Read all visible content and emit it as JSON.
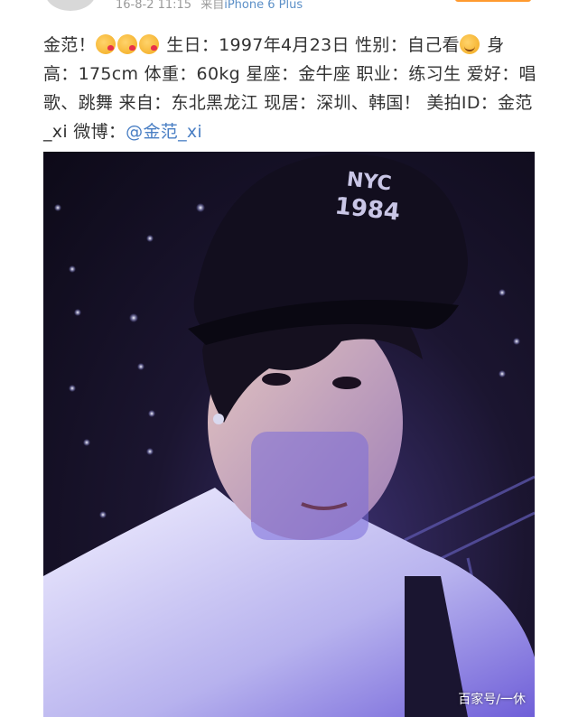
{
  "header": {
    "timestamp": "16-8-2 11:15",
    "source_prefix": "来自",
    "source_device": "iPhone 6 Plus"
  },
  "post": {
    "segments": [
      {
        "type": "text",
        "value": "金范！"
      },
      {
        "type": "emoji",
        "name": "kiss-emoji"
      },
      {
        "type": "emoji",
        "name": "kiss-emoji"
      },
      {
        "type": "emoji",
        "name": "kiss-emoji"
      },
      {
        "type": "text",
        "value": " 生日：1997年4月23日 性别：自己看"
      },
      {
        "type": "emoji",
        "name": "blush-emoji"
      },
      {
        "type": "text",
        "value": " 身高：175cm 体重：60kg 星座：金牛座 职业：练习生 爱好：唱歌、跳舞 来自：东北黑龙江 现居：深圳、韩国！ 美拍ID：金范_xi 微博："
      },
      {
        "type": "mention",
        "value": "@金范_xi"
      }
    ]
  },
  "photo": {
    "cap_text_line1": "NYC",
    "cap_text_line2": "1984"
  },
  "watermark": "百家号/一休",
  "colors": {
    "text": "#333333",
    "mention": "#4a7fc4",
    "meta": "#9a9a9a",
    "follow_button": "#ff9a2f"
  }
}
